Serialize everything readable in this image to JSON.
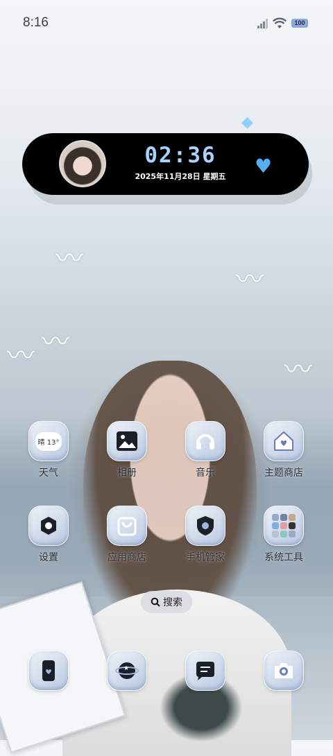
{
  "status_bar": {
    "time": "8:16",
    "battery": "100"
  },
  "widget": {
    "time": "02:36",
    "date": "2025年11月28日 星期五"
  },
  "apps_row1": [
    {
      "label": "天气",
      "icon": "weather-icon",
      "icon_text": "晴 13°"
    },
    {
      "label": "相册",
      "icon": "gallery-icon"
    },
    {
      "label": "音乐",
      "icon": "headphones-icon"
    },
    {
      "label": "主题商店",
      "icon": "theme-store-icon"
    }
  ],
  "apps_row2": [
    {
      "label": "设置",
      "icon": "settings-icon"
    },
    {
      "label": "应用商店",
      "icon": "app-store-icon"
    },
    {
      "label": "手机管家",
      "icon": "phone-manager-icon"
    },
    {
      "label": "系统工具",
      "icon": "system-tools-icon"
    }
  ],
  "search": {
    "label": "搜索"
  },
  "dock": [
    {
      "icon": "phone-icon"
    },
    {
      "icon": "browser-icon"
    },
    {
      "icon": "messages-icon"
    },
    {
      "icon": "camera-icon"
    }
  ],
  "colors": {
    "widget_bg": "#000000",
    "clock_text": "#a9d3ff",
    "heart": "#56aef5",
    "battery": "#8fa9da"
  }
}
